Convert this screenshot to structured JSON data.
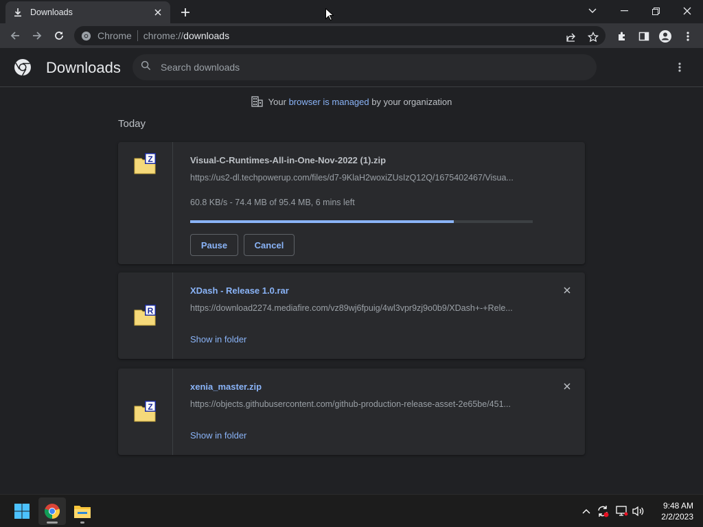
{
  "window": {
    "tab_title": "Downloads",
    "omnibox_site": "Chrome",
    "url_scheme": "chrome://",
    "url_host": "downloads"
  },
  "page": {
    "title": "Downloads",
    "search_placeholder": "Search downloads",
    "managed_prefix": "Your ",
    "managed_link": "browser is managed",
    "managed_suffix": " by your organization",
    "section_title": "Today"
  },
  "downloads": [
    {
      "filename": "Visual-C-Runtimes-All-in-One-Nov-2022 (1).zip",
      "url": "https://us2-dl.techpowerup.com/files/d7-9KlaH2woxiZUsIzQ12Q/1675402467/Visua...",
      "status": "60.8 KB/s - 74.4 MB of 95.4 MB, 6 mins left",
      "progress": 0.77,
      "pause_label": "Pause",
      "cancel_label": "Cancel",
      "icon_letter": "Z"
    },
    {
      "filename": "XDash - Release 1.0.rar",
      "url": "https://download2274.mediafire.com/vz89wj6fpuig/4wl3vpr9zj9o0b9/XDash+-+Rele...",
      "action_label": "Show in folder",
      "icon_letter": "R"
    },
    {
      "filename": "xenia_master.zip",
      "url": "https://objects.githubusercontent.com/github-production-release-asset-2e65be/451...",
      "action_label": "Show in folder",
      "icon_letter": "Z"
    }
  ],
  "taskbar": {
    "time": "9:48 AM",
    "date": "2/2/2023"
  },
  "colors": {
    "accent": "#8ab4f8",
    "background": "#202124",
    "card": "#292a2d"
  }
}
